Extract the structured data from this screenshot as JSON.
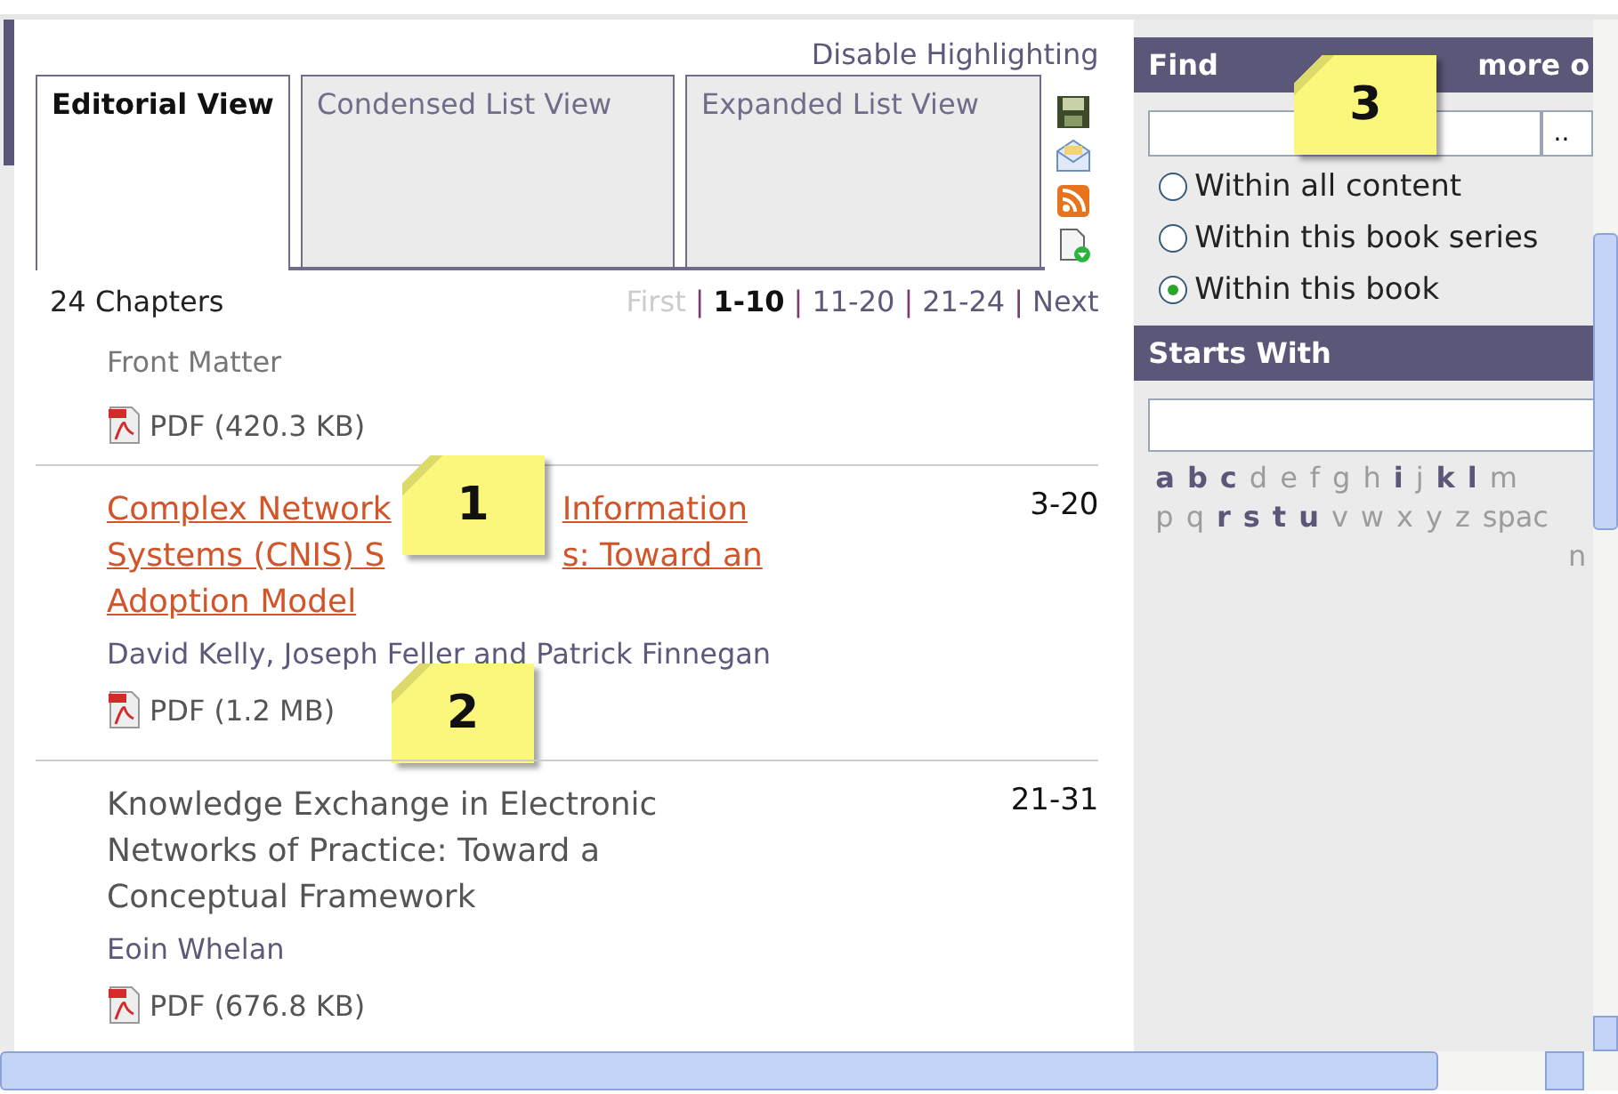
{
  "toolbar": {
    "highlight_link": "Disable Highlighting"
  },
  "tabs": [
    {
      "label": "Editorial View",
      "selected": true
    },
    {
      "label": "Condensed List View",
      "selected": false
    },
    {
      "label": "Expanded List View",
      "selected": false
    }
  ],
  "chapter_count": "24 Chapters",
  "pager": [
    {
      "kind": "link",
      "label": "First",
      "disabled": true,
      "selected": false
    },
    {
      "kind": "separator",
      "label": "|"
    },
    {
      "kind": "link",
      "label": "1-10",
      "disabled": false,
      "selected": true
    },
    {
      "kind": "separator",
      "label": "|"
    },
    {
      "kind": "link",
      "label": "11-20",
      "disabled": false,
      "selected": false
    },
    {
      "kind": "separator",
      "label": "|"
    },
    {
      "kind": "link",
      "label": "21-24",
      "disabled": false,
      "selected": false
    },
    {
      "kind": "separator",
      "label": "|"
    },
    {
      "kind": "link",
      "label": "Next",
      "disabled": false,
      "selected": false
    }
  ],
  "chapters": [
    {
      "kind": "front",
      "title_lines": [
        [
          "Front Matter"
        ]
      ],
      "pdf": "PDF (420.3 KB)"
    },
    {
      "kind": "chapter",
      "active": true,
      "title_lines": [
        [
          "Complex Network",
          "Information"
        ],
        [
          "Systems (CNIS) S",
          "s: Toward an"
        ],
        [
          "Adoption Model"
        ]
      ],
      "pages": "3-20",
      "authors": "David Kelly, Joseph Feller and Patrick Finnegan",
      "pdf": "PDF (1.2 MB)",
      "title_callout": "1",
      "pdf_callout": "2"
    },
    {
      "kind": "chapter",
      "active": false,
      "title_lines": [
        [
          "Knowledge Exchange in Electronic"
        ],
        [
          "Networks of Practice: Toward a"
        ],
        [
          "Conceptual Framework"
        ]
      ],
      "pages": "21-31",
      "authors": "Eoin Whelan",
      "pdf": "PDF (676.8 KB)"
    }
  ],
  "find": {
    "title": "Find",
    "more": "more o",
    "button": "..",
    "callout": "3",
    "options": [
      {
        "label": "Within all content",
        "selected": false
      },
      {
        "label": "Within this book series",
        "selected": false
      },
      {
        "label": "Within this book",
        "selected": true
      }
    ]
  },
  "starts_with": {
    "title": "Starts With",
    "letter_rows": [
      [
        {
          "text": "a",
          "disabled": false
        },
        {
          "text": "b",
          "disabled": false
        },
        {
          "text": "c",
          "disabled": false
        },
        {
          "text": "d",
          "disabled": true
        },
        {
          "text": "e",
          "disabled": true
        },
        {
          "text": "f",
          "disabled": true
        },
        {
          "text": "g",
          "disabled": true
        },
        {
          "text": "h",
          "disabled": true
        },
        {
          "text": "i",
          "disabled": false
        },
        {
          "text": "j",
          "disabled": true
        },
        {
          "text": "k",
          "disabled": false
        },
        {
          "text": "l",
          "disabled": false
        },
        {
          "text": "m",
          "disabled": true
        }
      ],
      [
        {
          "text": "p",
          "disabled": true
        },
        {
          "text": "q",
          "disabled": true
        },
        {
          "text": "r",
          "disabled": false
        },
        {
          "text": "s",
          "disabled": false
        },
        {
          "text": "t",
          "disabled": false
        },
        {
          "text": "u",
          "disabled": false
        },
        {
          "text": "v",
          "disabled": true
        },
        {
          "text": "w",
          "disabled": true
        },
        {
          "text": "x",
          "disabled": true
        },
        {
          "text": "y",
          "disabled": true
        },
        {
          "text": "z",
          "disabled": true
        },
        {
          "text": "spac",
          "disabled": true
        }
      ],
      [
        {
          "text": "n",
          "disabled": true
        }
      ]
    ]
  }
}
